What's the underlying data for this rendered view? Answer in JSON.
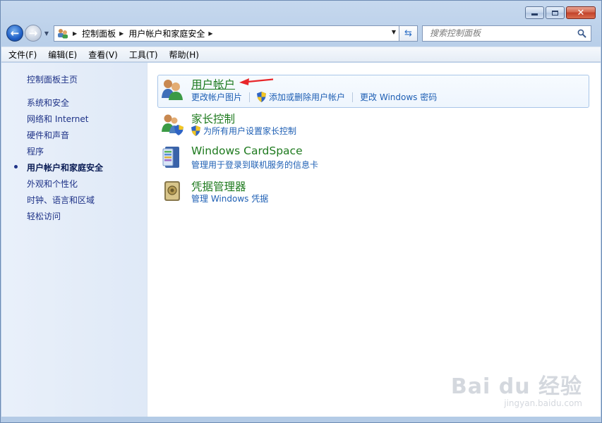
{
  "window": {
    "caption_buttons": {
      "minimize": "minimize",
      "maximize": "maximize",
      "close": "✕"
    }
  },
  "navigation": {
    "back_icon": "back-arrow-icon",
    "forward_icon": "forward-arrow-icon",
    "breadcrumbs": [
      "控制面板",
      "用户帐户和家庭安全"
    ],
    "search_placeholder": "搜索控制面板"
  },
  "menubar": {
    "items": [
      "文件(F)",
      "编辑(E)",
      "查看(V)",
      "工具(T)",
      "帮助(H)"
    ]
  },
  "sidebar": {
    "home": "控制面板主页",
    "items": [
      {
        "label": "系统和安全",
        "active": false
      },
      {
        "label": "网络和 Internet",
        "active": false
      },
      {
        "label": "硬件和声音",
        "active": false
      },
      {
        "label": "程序",
        "active": false
      },
      {
        "label": "用户帐户和家庭安全",
        "active": true
      },
      {
        "label": "外观和个性化",
        "active": false
      },
      {
        "label": "时钟、语言和区域",
        "active": false
      },
      {
        "label": "轻松访问",
        "active": false
      }
    ]
  },
  "categories": [
    {
      "title": "用户帐户",
      "links": [
        "更改帐户图片",
        "添加或删除用户帐户",
        "更改 Windows 密码"
      ]
    },
    {
      "title": "家长控制",
      "links": [
        "为所有用户设置家长控制"
      ]
    },
    {
      "title": "Windows CardSpace",
      "links": [
        "管理用于登录到联机服务的信息卡"
      ]
    },
    {
      "title": "凭据管理器",
      "links": [
        "管理 Windows 凭据"
      ]
    }
  ],
  "watermark": {
    "logo": "Bai du 经验",
    "url": "jingyan.baidu.com"
  },
  "colors": {
    "category_title": "#1e7a1e",
    "link": "#1e5fb4",
    "sidebar_link": "#1e3287",
    "annotation_arrow": "#e8262a"
  }
}
